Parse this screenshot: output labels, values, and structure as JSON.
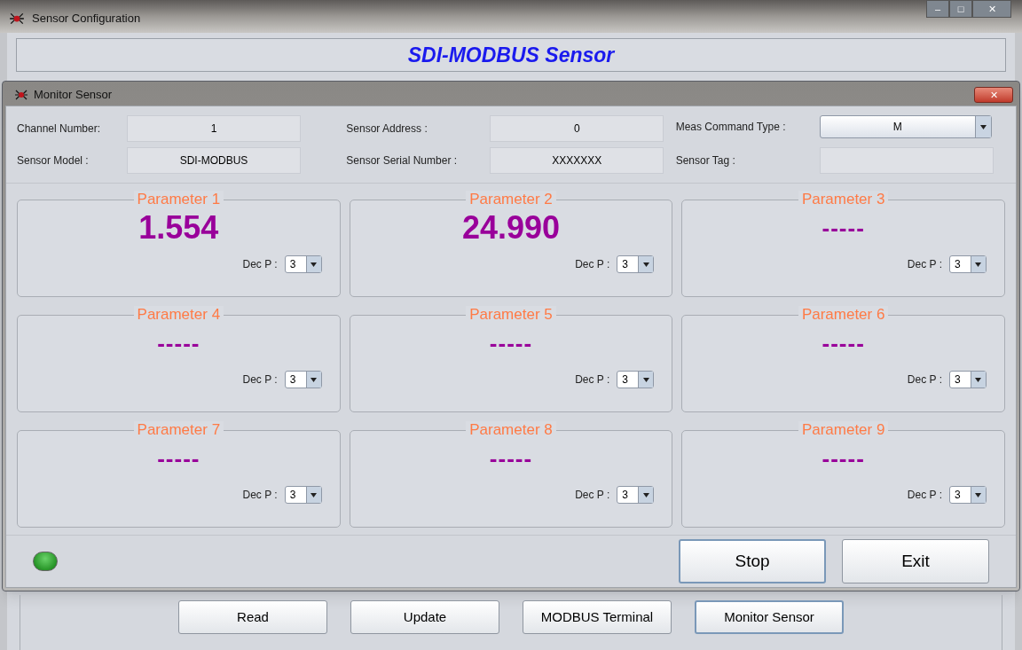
{
  "window": {
    "title": "Sensor Configuration",
    "controls": [
      "–",
      "□",
      "✕"
    ]
  },
  "header": {
    "title": "SDI-MODBUS Sensor"
  },
  "dialog": {
    "title": "Monitor Sensor",
    "close": "✕",
    "fields": [
      {
        "label": "Channel Number:",
        "value": "1",
        "kind": "text"
      },
      {
        "label": "Sensor Address :",
        "value": "0",
        "kind": "text"
      },
      {
        "label": "Meas Command Type :",
        "value": "M",
        "kind": "select"
      },
      {
        "label": "Sensor Model :",
        "value": "SDI-MODBUS",
        "kind": "text"
      },
      {
        "label": "Sensor Serial Number :",
        "value": "XXXXXXX",
        "kind": "text"
      },
      {
        "label": "Sensor Tag :",
        "kind": "text"
      }
    ],
    "parameters": [
      {
        "title": "Parameter 1",
        "value": "1.554",
        "dec_label": "Dec P :",
        "dec": "3"
      },
      {
        "title": "Parameter 2",
        "value": "24.990",
        "dec_label": "Dec P :",
        "dec": "3"
      },
      {
        "title": "Parameter 3",
        "value": "-----",
        "dec_label": "Dec P :",
        "dec": "3"
      },
      {
        "title": "Parameter 4",
        "value": "-----",
        "dec_label": "Dec P :",
        "dec": "3"
      },
      {
        "title": "Parameter 5",
        "value": "-----",
        "dec_label": "Dec P :",
        "dec": "3"
      },
      {
        "title": "Parameter 6",
        "value": "-----",
        "dec_label": "Dec P :",
        "dec": "3"
      },
      {
        "title": "Parameter 7",
        "value": "-----",
        "dec_label": "Dec P :",
        "dec": "3"
      },
      {
        "title": "Parameter 8",
        "value": "-----",
        "dec_label": "Dec P :",
        "dec": "3"
      },
      {
        "title": "Parameter 9",
        "value": "-----",
        "dec_label": "Dec P :",
        "dec": "3"
      }
    ],
    "led": {
      "on": true
    },
    "buttons": [
      {
        "label": "Stop",
        "focused": true
      },
      {
        "label": "Exit",
        "focused": false
      }
    ]
  },
  "bottom_buttons": [
    {
      "label": "Read",
      "focused": false
    },
    {
      "label": "Update",
      "focused": false
    },
    {
      "label": "MODBUS Terminal",
      "focused": false
    },
    {
      "label": "Monitor Sensor",
      "focused": true
    }
  ]
}
